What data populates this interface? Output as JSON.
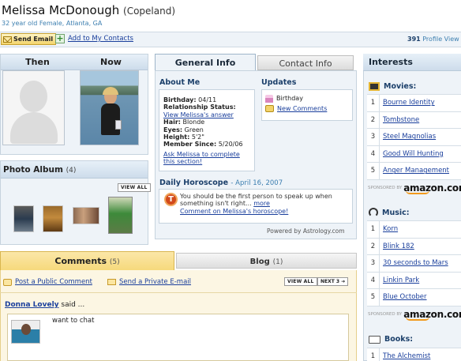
{
  "profile": {
    "name": "Melissa McDonough",
    "maiden": "(Copeland)",
    "subtitle": "32 year old Female, Atlanta, GA",
    "views_count": "391",
    "views_label": "Profile View"
  },
  "actions": {
    "send_email": "Send Email",
    "add_contact": "Add to My Contacts"
  },
  "photos": {
    "then": "Then",
    "now": "Now"
  },
  "album": {
    "title": "Photo Album",
    "count": "(4)",
    "view_all": "VIEW ALL"
  },
  "info_tabs": {
    "general": "General Info",
    "contact": "Contact Info"
  },
  "about": {
    "title": "About Me",
    "birthday_label": "Birthday:",
    "birthday": "04/11",
    "relationship_label": "Relationship Status:",
    "relationship_link": "View Melissa's answer",
    "hair_label": "Hair:",
    "hair": "Blonde",
    "eyes_label": "Eyes:",
    "eyes": "Green",
    "height_label": "Height:",
    "height": "5'2\"",
    "member_label": "Member Since:",
    "member": "5/20/06",
    "ask_link": "Ask Melissa to complete this section!"
  },
  "updates": {
    "title": "Updates",
    "birthday": "Birthday",
    "new_comments": "New Comments"
  },
  "horoscope": {
    "title": "Daily Horoscope",
    "date": "- April 16, 2007",
    "text": "You should be the first person to speak up when something isn't right...",
    "more": "more",
    "comment_link": "Comment on Melissa's horoscope!",
    "powered": "Powered by Astrology.com"
  },
  "comment_tabs": {
    "comments": "Comments",
    "comments_count": "(5)",
    "blog": "Blog",
    "blog_count": "(1)"
  },
  "comments": {
    "post_public": "Post a Public Comment",
    "post_private": "Send a Private E-mail",
    "view_all": "VIEW ALL",
    "next": "NEXT 3 ➔",
    "author": "Donna Lovely",
    "said": "said ...",
    "text": "want to chat"
  },
  "interests": {
    "title": "Interests",
    "movies_title": "Movies:",
    "movies": [
      "Bourne Identity",
      "Tombstone",
      "Steel Magnolias",
      "Good Will Hunting",
      "Anger Management"
    ],
    "music_title": "Music:",
    "music": [
      "Korn",
      "Blink 182",
      "30 seconds to Mars",
      "Linkin Park",
      "Blue October"
    ],
    "books_title": "Books:",
    "books": [
      "The Alchemist"
    ],
    "sponsored": "SPONSORED BY",
    "amazon": "amazon.com"
  },
  "colors": {
    "link": "#1a3f9c",
    "panel_bg": "#eef3f8",
    "comments_tab": "#f6d97c"
  }
}
